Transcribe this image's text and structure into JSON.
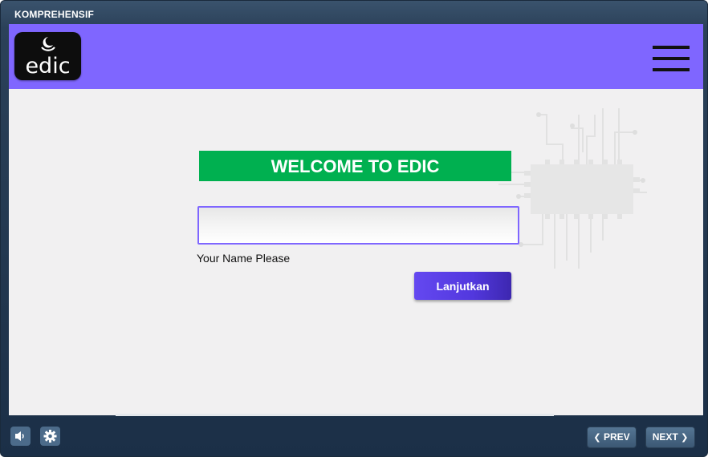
{
  "window": {
    "title": "KOMPREHENSIF"
  },
  "header": {
    "logo_text": "edic",
    "logo_icon": "crescent-moon-icon",
    "menu_icon": "hamburger-menu-icon",
    "background": "#7f66ff"
  },
  "main": {
    "welcome_text": "WELCOME TO EDIC",
    "welcome_bg": "#00b050",
    "name_input_value": "",
    "name_label": "Your Name Please",
    "submit_label": "Lanjutkan",
    "submit_color": "#5a3fe6",
    "decoration_icon": "circuit-chip-icon"
  },
  "footer": {
    "volume_icon": "speaker-icon",
    "settings_icon": "gear-icon",
    "prev_label": "PREV",
    "next_label": "NEXT",
    "prev_icon": "chevron-left-icon",
    "next_icon": "chevron-right-icon"
  }
}
